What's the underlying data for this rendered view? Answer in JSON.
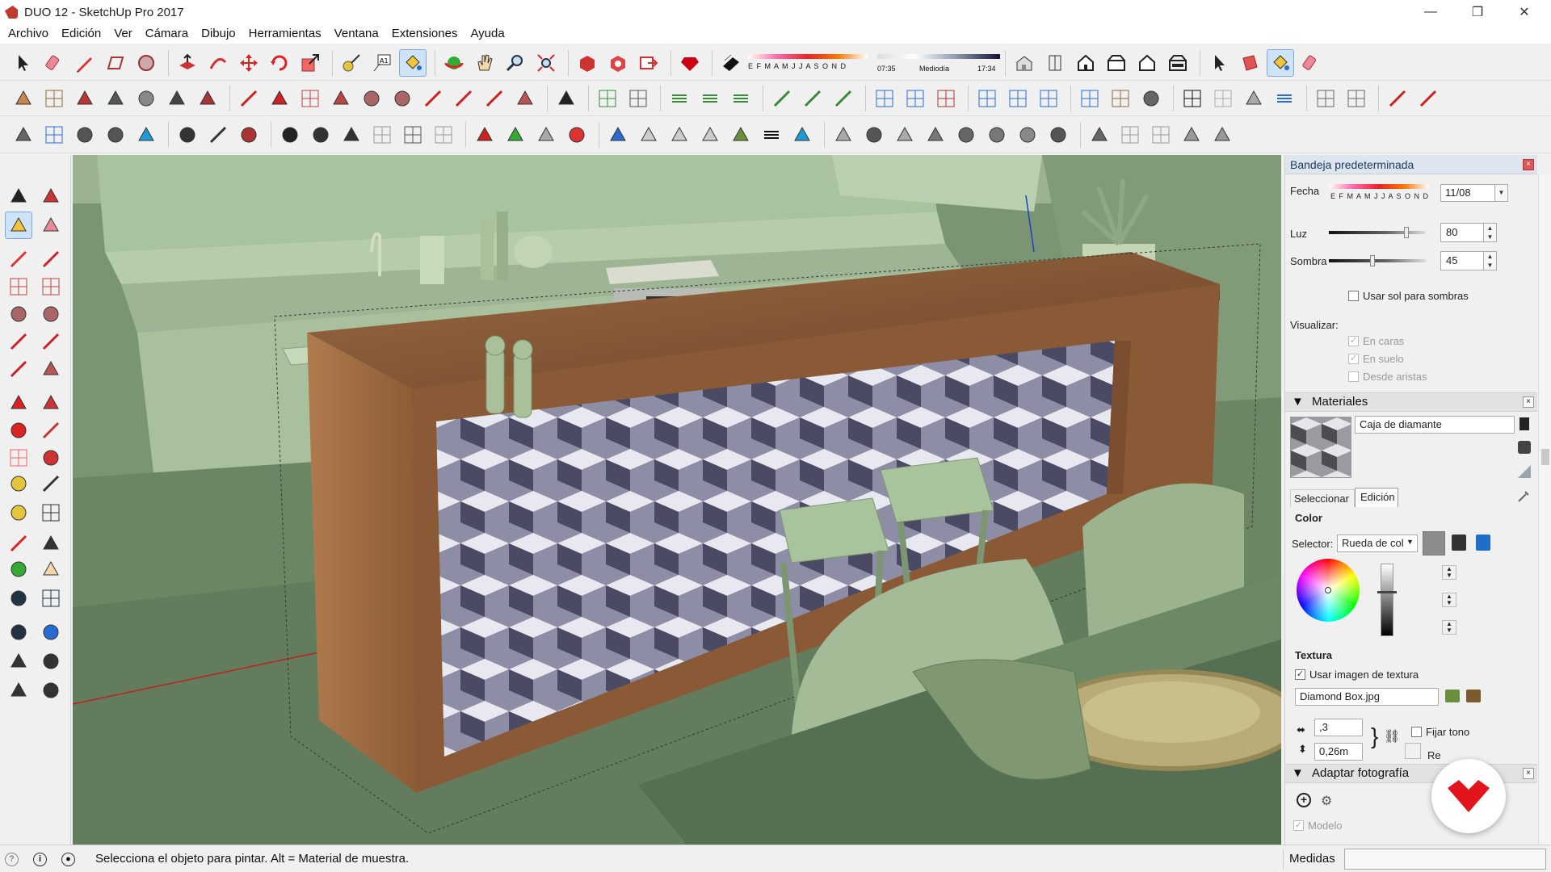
{
  "window": {
    "title": "DUO 12 - SketchUp Pro 2017",
    "minimize": "—",
    "maximize": "❐",
    "close": "✕"
  },
  "menu": [
    "Archivo",
    "Edición",
    "Ver",
    "Cámara",
    "Dibujo",
    "Herramientas",
    "Ventana",
    "Extensiones",
    "Ayuda"
  ],
  "toolbar1": {
    "shadow_months": "E F M A M J J A S O N D",
    "time_start": "07:35",
    "time_mid": "Mediodía",
    "time_end": "17:34"
  },
  "tray": {
    "title": "Bandeja predeterminada",
    "shadows": {
      "date_label": "Fecha",
      "months": "E F M A M J J A S O N D",
      "date_value": "11/08",
      "light_label": "Luz",
      "light_value": "80",
      "light_fraction": 0.8,
      "shade_label": "Sombra",
      "shade_value": "45",
      "shade_fraction": 0.45,
      "use_sun": "Usar sol para sombras",
      "display_label": "Visualizar:",
      "on_faces": "En caras",
      "on_ground": "En suelo",
      "from_edges": "Desde aristas"
    },
    "materials": {
      "header": "Materiales",
      "material_name": "Caja de diamante",
      "tab_select": "Seleccionar",
      "tab_edit": "Edición",
      "color_label": "Color",
      "selector_label": "Selector:",
      "selector_value": "Rueda de col",
      "texture_label": "Textura",
      "use_texture": "Usar imagen de textura",
      "texture_file": "Diamond Box.jpg",
      "width_value": ",3",
      "height_value": "0,26m",
      "fix_hue": "Fijar tono",
      "reset_partial": "Re"
    },
    "match_photo": {
      "header": "Adaptar fotografía",
      "model_label": "Modelo"
    }
  },
  "status": {
    "message": "Selecciona el objeto para pintar. Alt = Material de muestra.",
    "measures_label": "Medidas"
  },
  "colors": {
    "accent_blue": "#1e6fc7",
    "scene_green": "#8fa884",
    "wood": "#8a5a36",
    "logo_red": "#e3141b"
  }
}
